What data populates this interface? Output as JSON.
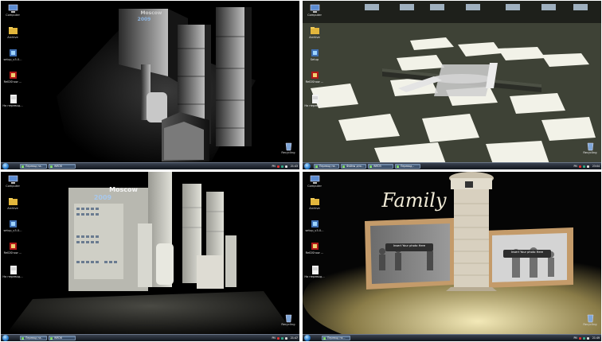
{
  "panels": [
    {
      "icons": [
        "Computer",
        "Archive",
        "setup_v3.0...",
        "ReIDShow ...",
        "На перевод..."
      ],
      "recycle": "Recycling",
      "taskbar": {
        "buttons": [
          "Перевод на..",
          "WRD6"
        ],
        "lang": "PN",
        "clock": "21:43"
      },
      "scene_text": {
        "title": "Moscow",
        "subtitle": "2009"
      }
    },
    {
      "icons": [
        "Computer",
        "Archive",
        "Setup",
        "ReIDShow ...",
        "На перевод..."
      ],
      "recycle": "Recycling",
      "taskbar": {
        "buttons": [
          "Перевод на..",
          "Файлы для...",
          "WRD5",
          "Перевод..."
        ],
        "lang": "PN",
        "clock": "23:04"
      },
      "scene_text": {}
    },
    {
      "icons": [
        "Computer",
        "Archive",
        "setup_v3.0...",
        "ReIDShow ...",
        "На перевод..."
      ],
      "recycle": "Recycling",
      "taskbar": {
        "buttons": [
          "Перевод на..",
          "WRD6"
        ],
        "lang": "PN",
        "clock": "21:47"
      },
      "scene_text": {
        "title": "Moscow",
        "subtitle": "2009"
      }
    },
    {
      "icons": [
        "Computer",
        "Archive",
        "setup_v3.0...",
        "ReIDShow ...",
        "На перевод..."
      ],
      "recycle": "Recycling",
      "taskbar": {
        "buttons": [
          "Перевод на..."
        ],
        "lang": "PN",
        "clock": "21:49"
      },
      "scene_text": {
        "title": "Family",
        "photo1": "Insert Your photo Here",
        "photo2": "Insert Your photo Here"
      }
    }
  ],
  "colors": {
    "taskbar": "#1c222c",
    "start": "#2a7fd0"
  }
}
